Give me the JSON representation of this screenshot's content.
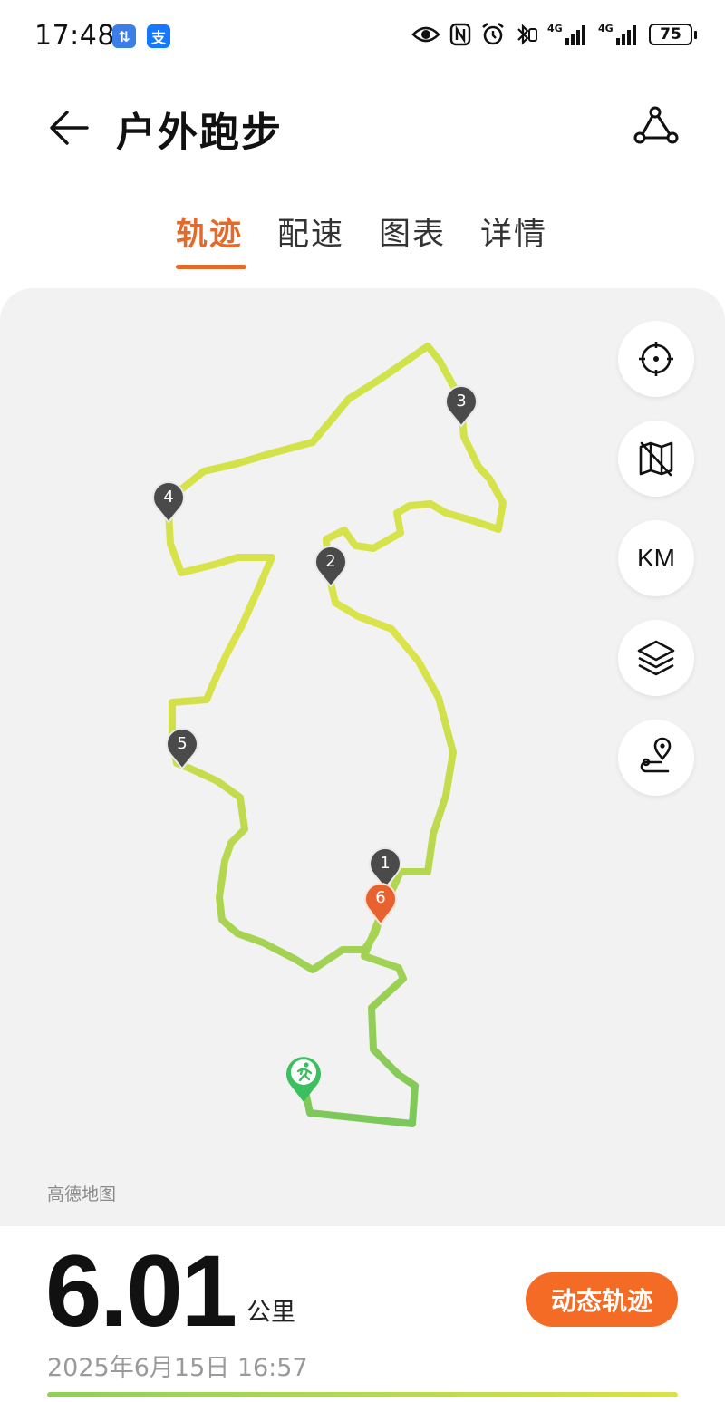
{
  "status_bar": {
    "time": "17:48",
    "app_badges": [
      {
        "icon": "transfer-app-icon",
        "color": "#3b7ee8",
        "glyph": "⇅"
      },
      {
        "icon": "alipay-icon",
        "color": "#1677ff",
        "glyph": "支"
      }
    ],
    "network_labels": [
      "4G",
      "4G"
    ],
    "battery": "75"
  },
  "header": {
    "title": "户外跑步",
    "back_icon": "back-arrow-icon",
    "route_icon": "route-share-icon"
  },
  "tabs": [
    {
      "label": "轨迹",
      "active": true
    },
    {
      "label": "配速",
      "active": false
    },
    {
      "label": "图表",
      "active": false
    },
    {
      "label": "详情",
      "active": false
    }
  ],
  "map": {
    "attribution": "高德地图",
    "controls": [
      {
        "icon": "locate-crosshair-icon"
      },
      {
        "icon": "map-off-icon"
      },
      {
        "icon": "km-toggle",
        "label": "KM"
      },
      {
        "icon": "layers-icon"
      },
      {
        "icon": "route-pin-icon"
      }
    ],
    "km_markers": [
      "1",
      "2",
      "3",
      "4",
      "5",
      "6"
    ],
    "colors": {
      "track_start": "#7cc85a",
      "track_mid": "#d6e24c",
      "marker": "#4a4a4a",
      "end_marker": "#e8622f",
      "start_marker": "#3bbf5f"
    }
  },
  "summary": {
    "distance": "6.01",
    "unit": "公里",
    "datetime": "2025年6月15日 16:57",
    "dynamic_button": "动态轨迹",
    "accent": "#f36b25",
    "progress": 1.0
  }
}
